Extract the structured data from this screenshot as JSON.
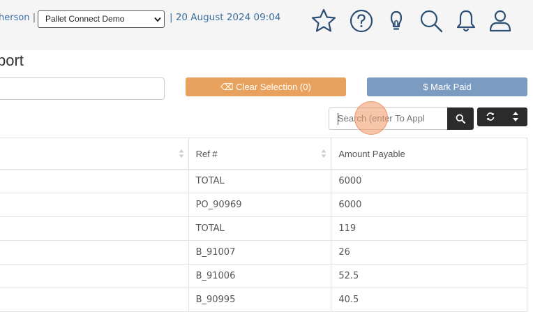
{
  "header": {
    "user_fragment": "herson",
    "separator": "|",
    "company_select": "Pallet Connect Demo",
    "datetime": "| 20 August 2024 09:04",
    "icons": [
      "star-icon",
      "help-icon",
      "lightbulb-icon",
      "search-icon",
      "bell-icon",
      "user-icon"
    ]
  },
  "page": {
    "title_fragment": "port"
  },
  "toolbar": {
    "clear_label": "⌫ Clear Selection (0)",
    "mark_paid_label": "$ Mark Paid",
    "search_placeholder": "Search (enter To Appl"
  },
  "table": {
    "columns": [
      "",
      "Ref #",
      "Amount Payable"
    ],
    "rows": [
      {
        "ref": "TOTAL",
        "amount": "6000"
      },
      {
        "ref": "PO_90969",
        "amount": "6000"
      },
      {
        "ref": "TOTAL",
        "amount": "119"
      },
      {
        "ref": "B_91007",
        "amount": "26"
      },
      {
        "ref": "B_91006",
        "amount": "52.5"
      },
      {
        "ref": "B_90995",
        "amount": "40.5"
      }
    ]
  },
  "colors": {
    "clear_button": "#e8a25e",
    "mark_paid_button": "#7b9bc0",
    "link_text": "#3a6fa0",
    "dark_button": "#2b2b2b"
  }
}
